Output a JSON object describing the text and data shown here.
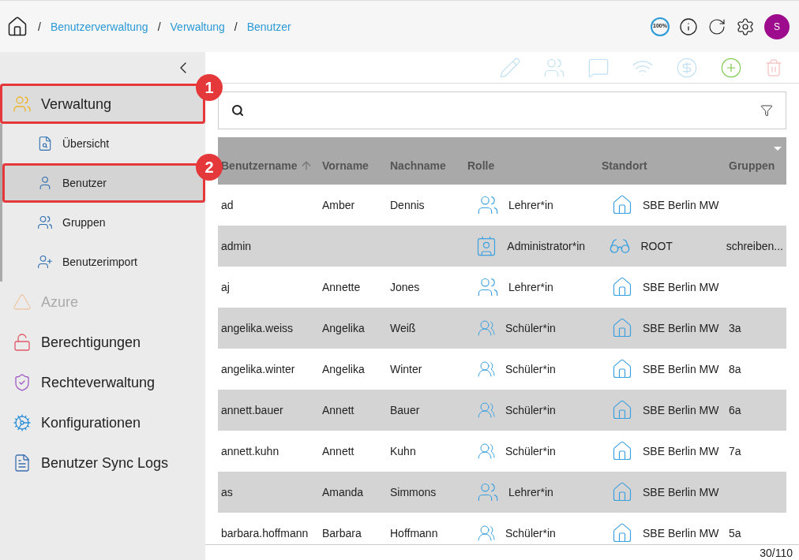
{
  "breadcrumb": [
    {
      "separator": "/",
      "label": "Benutzerverwaltung"
    },
    {
      "separator": "/",
      "label": "Verwaltung"
    },
    {
      "separator": "/",
      "label": "Benutzer"
    }
  ],
  "header": {
    "zoom_badge": "100%",
    "avatar": "S"
  },
  "sidebar": {
    "items": [
      {
        "kind": "admin",
        "label": "Verwaltung",
        "disabled": false,
        "callout": "1",
        "children": [
          {
            "kind": "overview",
            "label": "Übersicht",
            "selected": false
          },
          {
            "kind": "user",
            "label": "Benutzer",
            "selected": true,
            "callout": "2"
          },
          {
            "kind": "groups",
            "label": "Gruppen",
            "selected": false
          },
          {
            "kind": "import",
            "label": "Benutzerimport",
            "selected": false
          }
        ]
      },
      {
        "kind": "azure",
        "label": "Azure",
        "disabled": true
      },
      {
        "kind": "lock",
        "label": "Berechtigungen",
        "disabled": false
      },
      {
        "kind": "shield",
        "label": "Rechteverwaltung",
        "disabled": false
      },
      {
        "kind": "cog",
        "label": "Konfigurationen",
        "disabled": false
      },
      {
        "kind": "log",
        "label": "Benutzer Sync Logs",
        "disabled": false
      }
    ]
  },
  "table": {
    "columns": [
      {
        "label": "Benutzername",
        "sorted": true
      },
      {
        "label": "Vorname",
        "sorted": false
      },
      {
        "label": "Nachname",
        "sorted": false
      },
      {
        "label": "Rolle",
        "sorted": false
      },
      {
        "label": "Standort",
        "sorted": false
      },
      {
        "label": "Gruppen",
        "sorted": false
      }
    ],
    "rows": [
      {
        "username": "ad",
        "first": "Amber",
        "last": "Dennis",
        "role": {
          "kind": "teacher",
          "label": "Lehrer*in"
        },
        "site": {
          "kind": "school",
          "label": "SBE Berlin MW"
        },
        "groups": ""
      },
      {
        "username": "admin",
        "first": "",
        "last": "",
        "role": {
          "kind": "admin",
          "label": "Administrator*in"
        },
        "site": {
          "kind": "root",
          "label": "ROOT"
        },
        "groups": "schreiben..."
      },
      {
        "username": "aj",
        "first": "Annette",
        "last": "Jones",
        "role": {
          "kind": "teacher",
          "label": "Lehrer*in"
        },
        "site": {
          "kind": "school",
          "label": "SBE Berlin MW"
        },
        "groups": ""
      },
      {
        "username": "angelika.weiss",
        "first": "Angelika",
        "last": "Weiß",
        "role": {
          "kind": "student",
          "label": "Schüler*in"
        },
        "site": {
          "kind": "school",
          "label": "SBE Berlin MW"
        },
        "groups": "3a"
      },
      {
        "username": "angelika.winter",
        "first": "Angelika",
        "last": "Winter",
        "role": {
          "kind": "student",
          "label": "Schüler*in"
        },
        "site": {
          "kind": "school",
          "label": "SBE Berlin MW"
        },
        "groups": "8a"
      },
      {
        "username": "annett.bauer",
        "first": "Annett",
        "last": "Bauer",
        "role": {
          "kind": "student",
          "label": "Schüler*in"
        },
        "site": {
          "kind": "school",
          "label": "SBE Berlin MW"
        },
        "groups": "6a"
      },
      {
        "username": "annett.kuhn",
        "first": "Annett",
        "last": "Kuhn",
        "role": {
          "kind": "student",
          "label": "Schüler*in"
        },
        "site": {
          "kind": "school",
          "label": "SBE Berlin MW"
        },
        "groups": "7a"
      },
      {
        "username": "as",
        "first": "Amanda",
        "last": "Simmons",
        "role": {
          "kind": "teacher",
          "label": "Lehrer*in"
        },
        "site": {
          "kind": "school",
          "label": "SBE Berlin MW"
        },
        "groups": ""
      },
      {
        "username": "barbara.hoffmann",
        "first": "Barbara",
        "last": "Hoffmann",
        "role": {
          "kind": "student",
          "label": "Schüler*in"
        },
        "site": {
          "kind": "school",
          "label": "SBE Berlin MW"
        },
        "groups": "5a"
      }
    ]
  },
  "pagination": "30/110"
}
